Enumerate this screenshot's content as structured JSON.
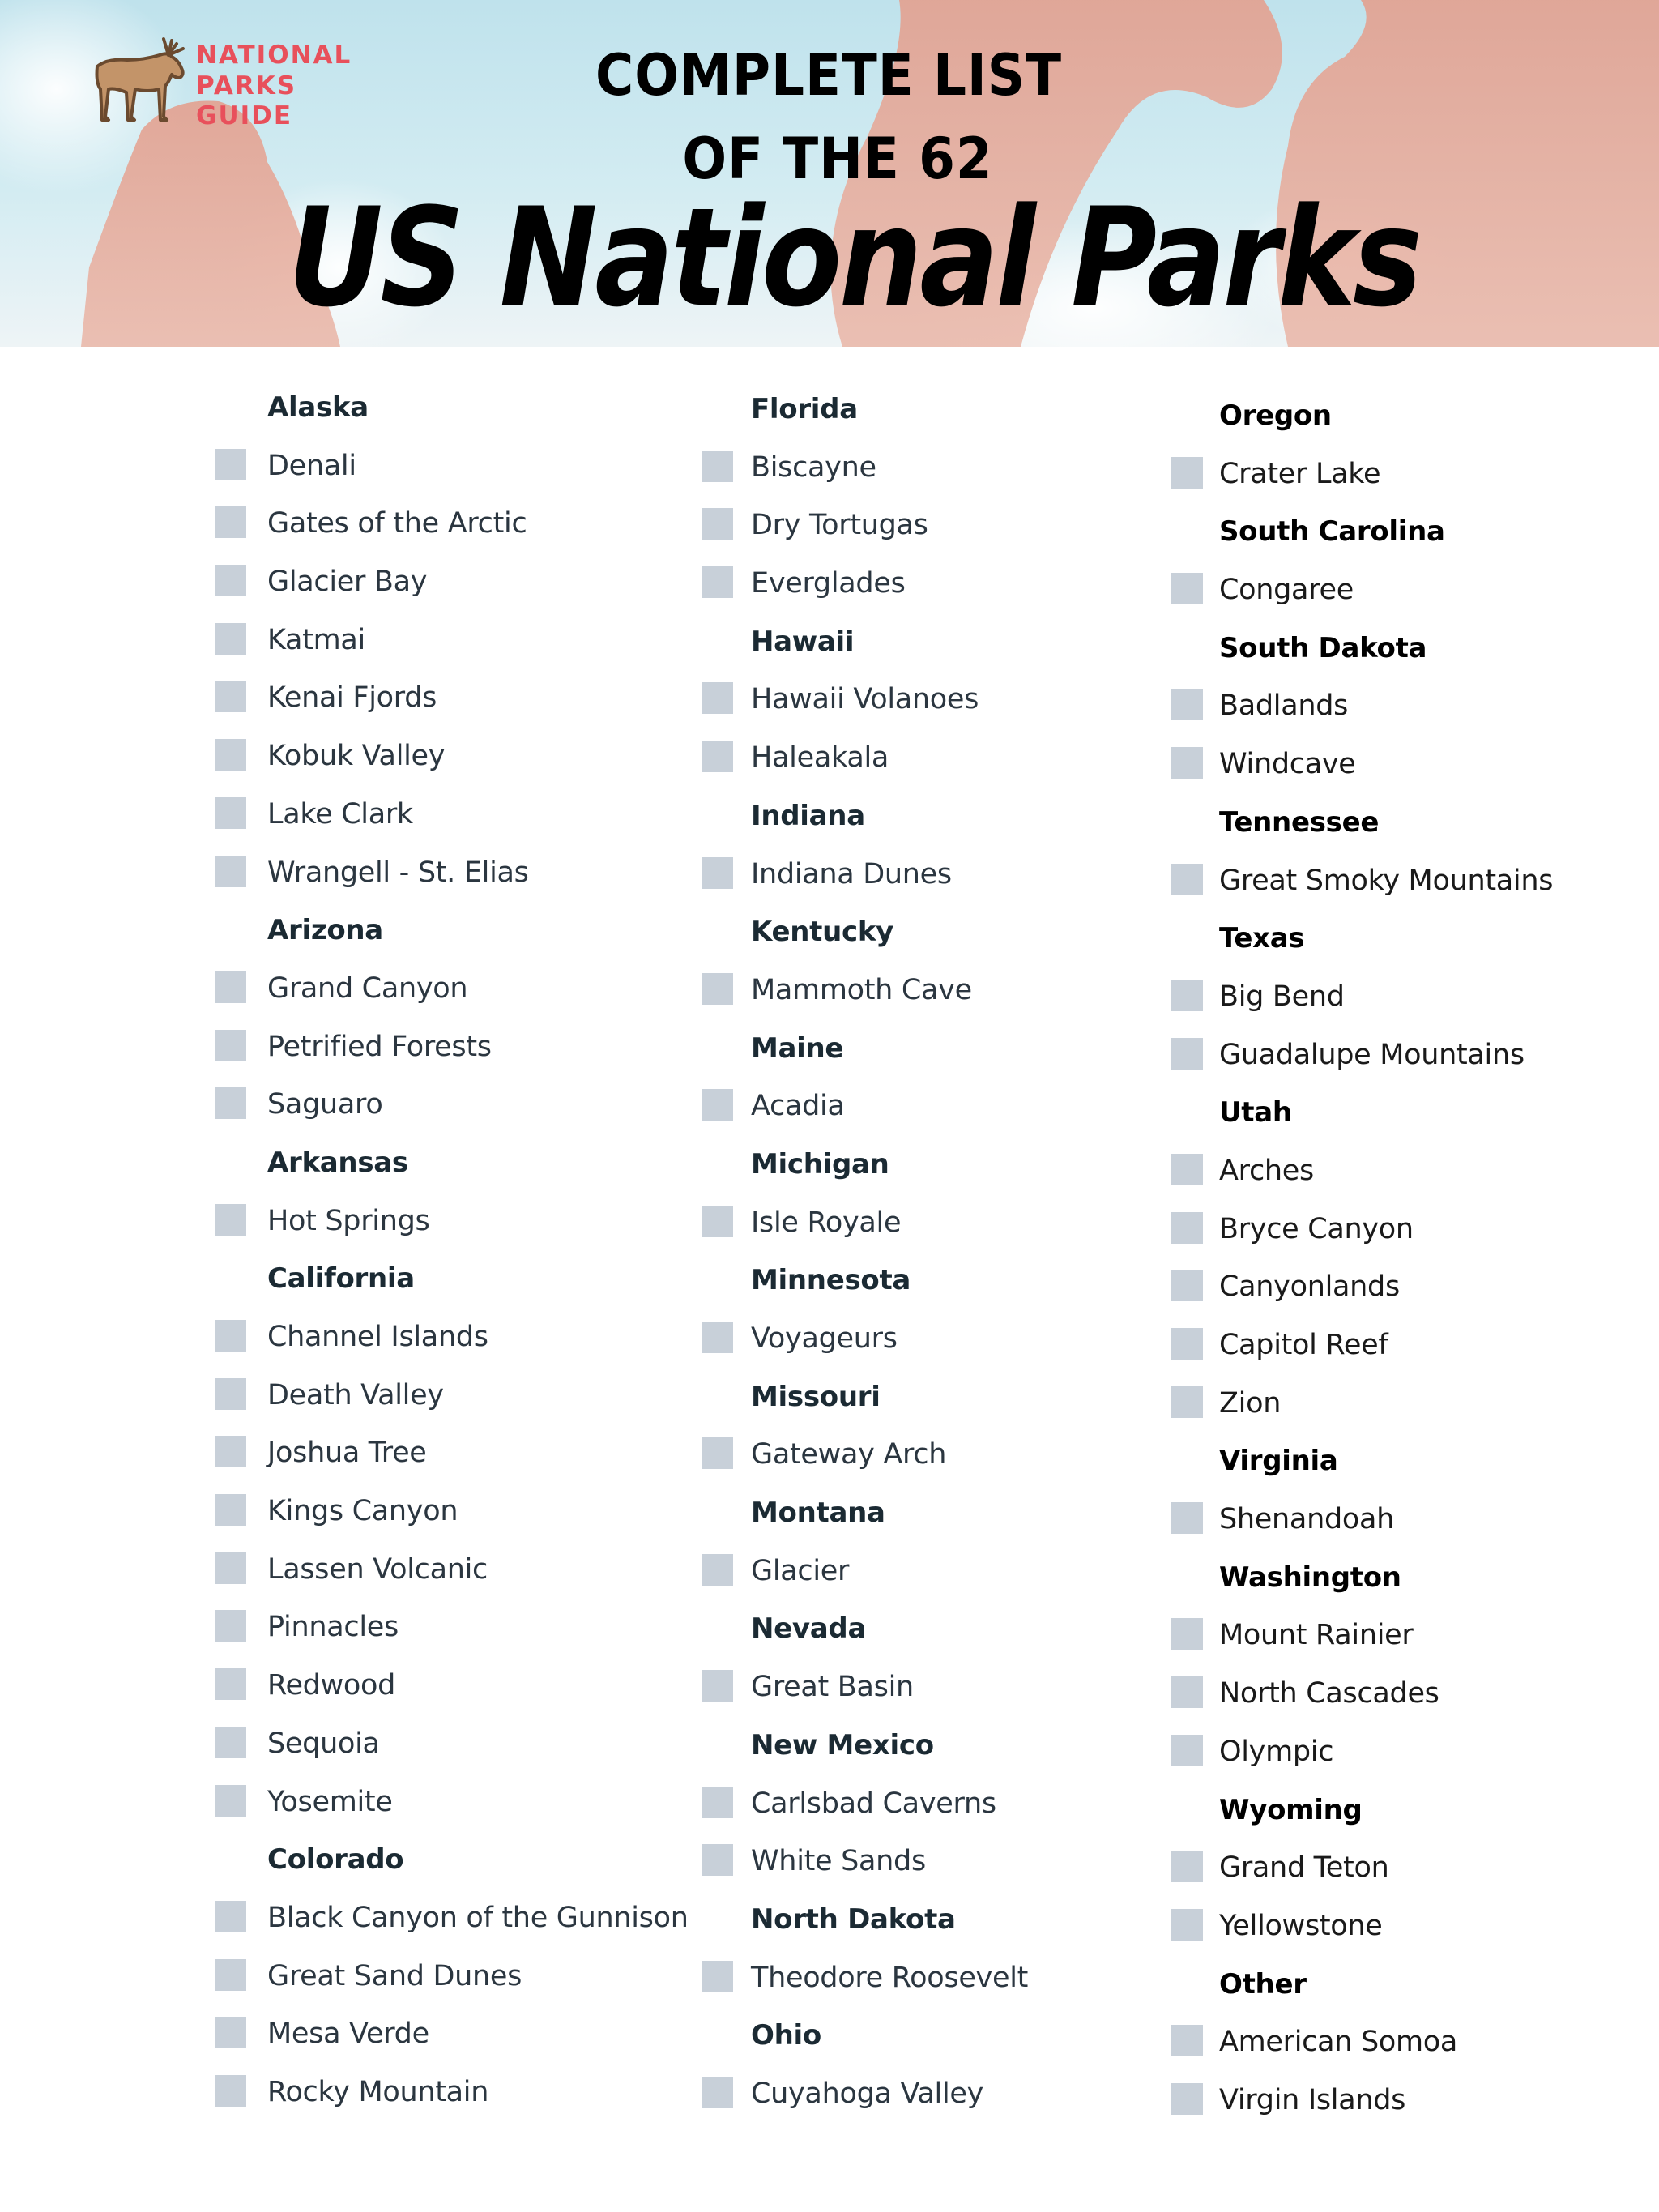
{
  "header": {
    "logo": {
      "icon": "moose-icon",
      "lines": [
        "NATIONAL",
        "PARKS",
        "GUIDE"
      ],
      "color": "#e8505b"
    },
    "title_line_1": "COMPLETE LIST",
    "title_line_2": "OF THE 62",
    "title_script": "US National Parks"
  },
  "colors": {
    "checkbox": "#c8d0d9",
    "heading": "#1b2a33",
    "item_text": "#2b3640"
  },
  "columns": [
    {
      "rows": [
        {
          "type": "state",
          "label": "Alaska"
        },
        {
          "type": "park",
          "label": "Denali",
          "checked": false
        },
        {
          "type": "park",
          "label": "Gates of the Arctic",
          "checked": false
        },
        {
          "type": "park",
          "label": "Glacier Bay",
          "checked": false
        },
        {
          "type": "park",
          "label": "Katmai",
          "checked": false
        },
        {
          "type": "park",
          "label": "Kenai Fjords",
          "checked": false
        },
        {
          "type": "park",
          "label": "Kobuk Valley",
          "checked": false
        },
        {
          "type": "park",
          "label": "Lake Clark",
          "checked": false
        },
        {
          "type": "park",
          "label": "Wrangell - St. Elias",
          "checked": false
        },
        {
          "type": "state",
          "label": "Arizona"
        },
        {
          "type": "park",
          "label": "Grand Canyon",
          "checked": false
        },
        {
          "type": "park",
          "label": "Petrified Forests",
          "checked": false
        },
        {
          "type": "park",
          "label": "Saguaro",
          "checked": false
        },
        {
          "type": "state",
          "label": "Arkansas"
        },
        {
          "type": "park",
          "label": "Hot Springs",
          "checked": false
        },
        {
          "type": "state",
          "label": "California"
        },
        {
          "type": "park",
          "label": "Channel Islands",
          "checked": false
        },
        {
          "type": "park",
          "label": "Death Valley",
          "checked": false
        },
        {
          "type": "park",
          "label": "Joshua Tree",
          "checked": false
        },
        {
          "type": "park",
          "label": "Kings Canyon",
          "checked": false
        },
        {
          "type": "park",
          "label": "Lassen Volcanic",
          "checked": false
        },
        {
          "type": "park",
          "label": "Pinnacles",
          "checked": false
        },
        {
          "type": "park",
          "label": "Redwood",
          "checked": false
        },
        {
          "type": "park",
          "label": "Sequoia",
          "checked": false
        },
        {
          "type": "park",
          "label": "Yosemite",
          "checked": false
        },
        {
          "type": "state",
          "label": "Colorado"
        },
        {
          "type": "park",
          "label": "Black Canyon of the Gunnison",
          "checked": false
        },
        {
          "type": "park",
          "label": "Great Sand Dunes",
          "checked": false
        },
        {
          "type": "park",
          "label": "Mesa Verde",
          "checked": false
        },
        {
          "type": "park",
          "label": "Rocky Mountain",
          "checked": false
        }
      ]
    },
    {
      "rows": [
        {
          "type": "state",
          "label": "Florida"
        },
        {
          "type": "park",
          "label": "Biscayne",
          "checked": false
        },
        {
          "type": "park",
          "label": "Dry Tortugas",
          "checked": false
        },
        {
          "type": "park",
          "label": "Everglades",
          "checked": false
        },
        {
          "type": "state",
          "label": "Hawaii"
        },
        {
          "type": "park",
          "label": "Hawaii Volanoes",
          "checked": false
        },
        {
          "type": "park",
          "label": "Haleakala",
          "checked": false
        },
        {
          "type": "state",
          "label": "Indiana"
        },
        {
          "type": "park",
          "label": "Indiana Dunes",
          "checked": false
        },
        {
          "type": "state",
          "label": "Kentucky"
        },
        {
          "type": "park",
          "label": "Mammoth Cave",
          "checked": false
        },
        {
          "type": "state",
          "label": "Maine"
        },
        {
          "type": "park",
          "label": "Acadia",
          "checked": false
        },
        {
          "type": "state",
          "label": "Michigan"
        },
        {
          "type": "park",
          "label": "Isle Royale",
          "checked": false
        },
        {
          "type": "state",
          "label": "Minnesota"
        },
        {
          "type": "park",
          "label": "Voyageurs",
          "checked": false
        },
        {
          "type": "state",
          "label": "Missouri"
        },
        {
          "type": "park",
          "label": "Gateway Arch",
          "checked": false
        },
        {
          "type": "state",
          "label": "Montana"
        },
        {
          "type": "park",
          "label": "Glacier",
          "checked": false
        },
        {
          "type": "state",
          "label": "Nevada"
        },
        {
          "type": "park",
          "label": "Great Basin",
          "checked": false
        },
        {
          "type": "state",
          "label": "New Mexico"
        },
        {
          "type": "park",
          "label": "Carlsbad Caverns",
          "checked": false
        },
        {
          "type": "park",
          "label": "White Sands",
          "checked": false
        },
        {
          "type": "state",
          "label": "North Dakota"
        },
        {
          "type": "park",
          "label": "Theodore Roosevelt",
          "checked": false
        },
        {
          "type": "state",
          "label": "Ohio"
        },
        {
          "type": "park",
          "label": "Cuyahoga Valley",
          "checked": false
        }
      ]
    },
    {
      "rows": [
        {
          "type": "state",
          "label": "Oregon"
        },
        {
          "type": "park",
          "label": "Crater Lake",
          "checked": false
        },
        {
          "type": "state",
          "label": "South Carolina"
        },
        {
          "type": "park",
          "label": "Congaree",
          "checked": false
        },
        {
          "type": "state",
          "label": "South Dakota"
        },
        {
          "type": "park",
          "label": "Badlands",
          "checked": false
        },
        {
          "type": "park",
          "label": "Windcave",
          "checked": false
        },
        {
          "type": "state",
          "label": "Tennessee"
        },
        {
          "type": "park",
          "label": "Great Smoky Mountains",
          "checked": false
        },
        {
          "type": "state",
          "label": "Texas"
        },
        {
          "type": "park",
          "label": "Big Bend",
          "checked": false
        },
        {
          "type": "park",
          "label": "Guadalupe Mountains",
          "checked": false
        },
        {
          "type": "state",
          "label": "Utah"
        },
        {
          "type": "park",
          "label": "Arches",
          "checked": false
        },
        {
          "type": "park",
          "label": "Bryce Canyon",
          "checked": false
        },
        {
          "type": "park",
          "label": "Canyonlands",
          "checked": false
        },
        {
          "type": "park",
          "label": "Capitol Reef",
          "checked": false
        },
        {
          "type": "park",
          "label": "Zion",
          "checked": false
        },
        {
          "type": "state",
          "label": "Virginia"
        },
        {
          "type": "park",
          "label": "Shenandoah",
          "checked": false
        },
        {
          "type": "state",
          "label": "Washington"
        },
        {
          "type": "park",
          "label": "Mount Rainier",
          "checked": false
        },
        {
          "type": "park",
          "label": "North Cascades",
          "checked": false
        },
        {
          "type": "park",
          "label": "Olympic",
          "checked": false
        },
        {
          "type": "state",
          "label": "Wyoming"
        },
        {
          "type": "park",
          "label": "Grand Teton",
          "checked": false
        },
        {
          "type": "park",
          "label": "Yellowstone",
          "checked": false
        },
        {
          "type": "state",
          "label": "Other"
        },
        {
          "type": "park",
          "label": "American Somoa",
          "checked": false
        },
        {
          "type": "park",
          "label": "Virgin Islands",
          "checked": false
        }
      ]
    }
  ]
}
